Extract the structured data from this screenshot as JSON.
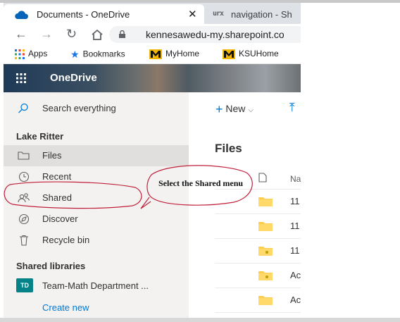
{
  "browser": {
    "tabs": [
      {
        "title": "Documents - OneDrive",
        "icon": "onedrive-cloud-icon",
        "active": true
      },
      {
        "title": "navigation - Sh",
        "icon": "urx-icon",
        "active": false
      }
    ],
    "url": "kennesawedu-my.sharepoint.co",
    "bookmarks": [
      {
        "label": "Apps",
        "icon": "apps-grid-icon"
      },
      {
        "label": "Bookmarks",
        "icon": "star-icon"
      },
      {
        "label": "MyHome",
        "icon": "ksu-logo-icon"
      },
      {
        "label": "KSUHome",
        "icon": "ksu-logo-icon"
      }
    ]
  },
  "onedrive": {
    "app_title": "OneDrive",
    "search_placeholder": "Search everything",
    "user_name": "Lake Ritter",
    "nav": [
      {
        "label": "Files",
        "icon": "folder-icon",
        "selected": true
      },
      {
        "label": "Recent",
        "icon": "clock-icon",
        "selected": false
      },
      {
        "label": "Shared",
        "icon": "people-icon",
        "selected": false
      },
      {
        "label": "Discover",
        "icon": "compass-icon",
        "selected": false
      },
      {
        "label": "Recycle bin",
        "icon": "recycle-bin-icon",
        "selected": false
      }
    ],
    "shared_libraries_head": "Shared libraries",
    "library": {
      "badge": "TD",
      "name": "Team-Math Department ..."
    },
    "create_new": "Create new",
    "toolbar": {
      "new_label": "New"
    },
    "files_title": "Files",
    "column_name": "Na",
    "rows": [
      {
        "text": "11",
        "type": "folder"
      },
      {
        "text": "11",
        "type": "folder"
      },
      {
        "text": "11",
        "type": "shared-folder"
      },
      {
        "text": "Ac",
        "type": "shared-folder"
      },
      {
        "text": "Ac",
        "type": "folder"
      }
    ]
  },
  "annotation": {
    "text": "Select the Shared menu",
    "color": "#c0203a"
  }
}
